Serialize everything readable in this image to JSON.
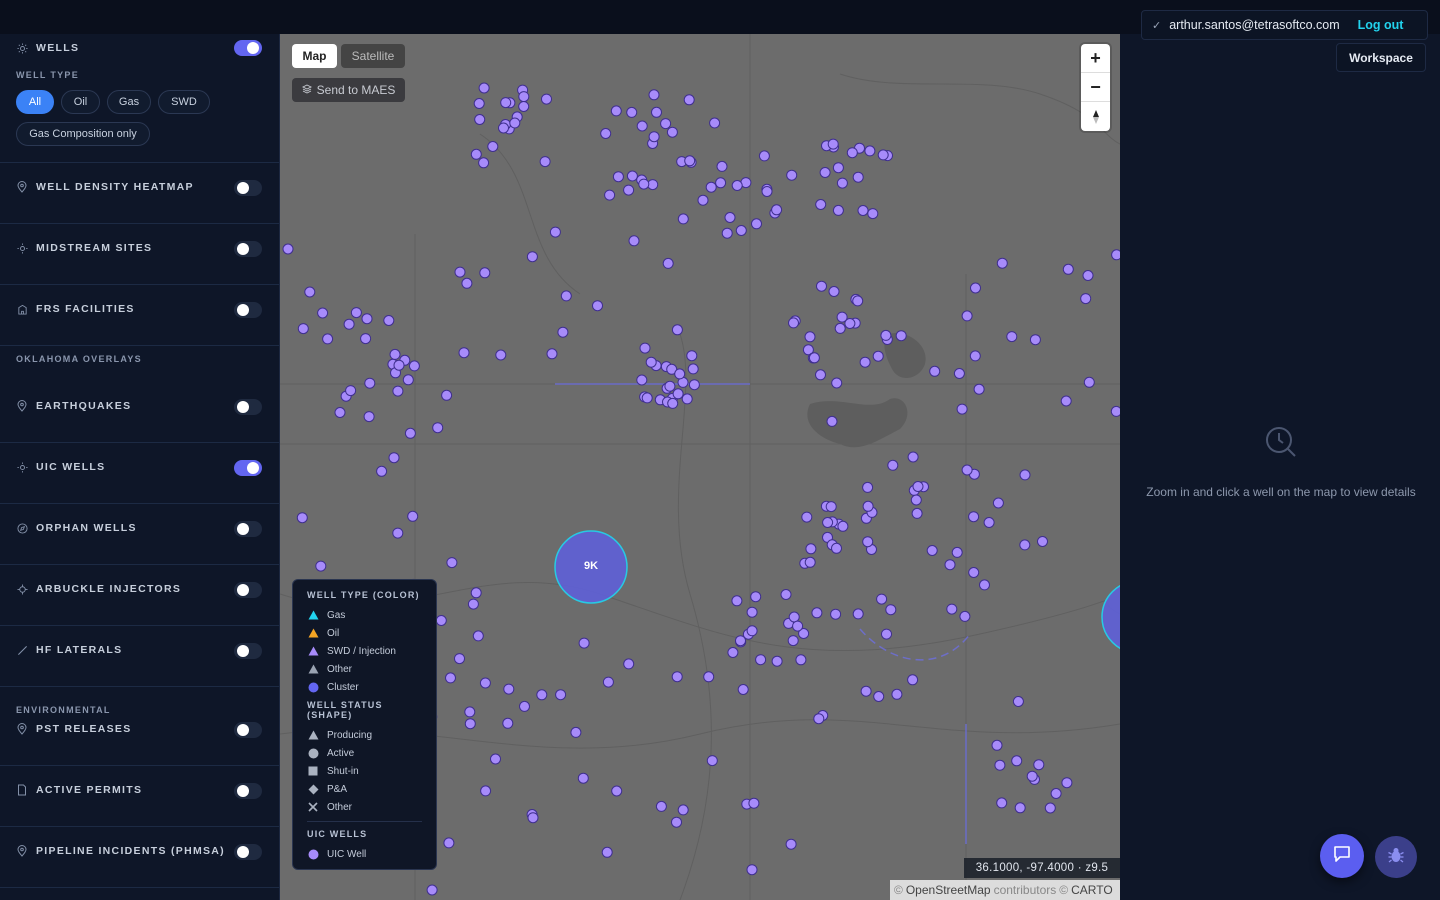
{
  "user": {
    "check_icon": "check-icon",
    "email": "arthur.santos@tetrasoftco.com",
    "logout_label": "Log out"
  },
  "workspace_label": "Workspace",
  "sidebar": {
    "wells": {
      "label": "Wells",
      "enabled": true
    },
    "well_type_label": "Well type",
    "well_type_filters": [
      "All",
      "Oil",
      "Gas",
      "SWD"
    ],
    "well_type_selected": "All",
    "gas_composition_label": "Gas Composition only",
    "layers": [
      {
        "label": "Well density heatmap",
        "icon": "map-pin-icon",
        "enabled": false
      },
      {
        "label": "Midstream sites",
        "icon": "sun-icon",
        "enabled": false
      },
      {
        "label": "FRS facilities",
        "icon": "building-icon",
        "enabled": false
      }
    ],
    "oklahoma_header": "Oklahoma overlays",
    "oklahoma_layers": [
      {
        "label": "Earthquakes",
        "icon": "map-pin-icon",
        "enabled": false
      },
      {
        "label": "UIC wells",
        "icon": "sun-icon",
        "enabled": true
      },
      {
        "label": "Orphan wells",
        "icon": "compass-icon",
        "enabled": false
      },
      {
        "label": "Arbuckle injectors",
        "icon": "crosshair-icon",
        "enabled": false
      },
      {
        "label": "HF laterals",
        "icon": "line-icon",
        "enabled": false
      }
    ],
    "environmental_header": "Environmental",
    "environmental_layers": [
      {
        "label": "PST releases",
        "icon": "map-pin-icon",
        "enabled": false
      },
      {
        "label": "Active permits",
        "icon": "document-icon",
        "enabled": false
      },
      {
        "label": "Pipeline incidents (PHMSA)",
        "icon": "map-pin-icon",
        "enabled": false
      }
    ]
  },
  "map": {
    "tabs": [
      "Map",
      "Satellite"
    ],
    "selected_tab": "Map",
    "send_label": "Send to MAES",
    "cluster_label": "9K",
    "coords": "36.1000, -97.4000 · z9.5",
    "attribution": {
      "copy1": "©",
      "osm": "OpenStreetMap",
      "contrib": "contributors",
      "copy2": "©",
      "carto": "CARTO"
    },
    "colors": {
      "well": "#a78bfa",
      "cluster": "#6366f1",
      "gas": "#22d3ee",
      "oil": "#f5a524",
      "swd": "#a78bfa",
      "other": "#9aa3b2"
    }
  },
  "legend": {
    "type_header": "Well type (color)",
    "types": [
      "Gas",
      "Oil",
      "SWD / Injection",
      "Other",
      "Cluster"
    ],
    "status_header": "Well status (shape)",
    "statuses": [
      "Producing",
      "Active",
      "Shut-in",
      "P&A",
      "Other"
    ],
    "uic_header": "UIC wells",
    "uic_item": "UIC Well"
  },
  "details": {
    "empty_text": "Zoom in and click a well on the map to view details"
  }
}
